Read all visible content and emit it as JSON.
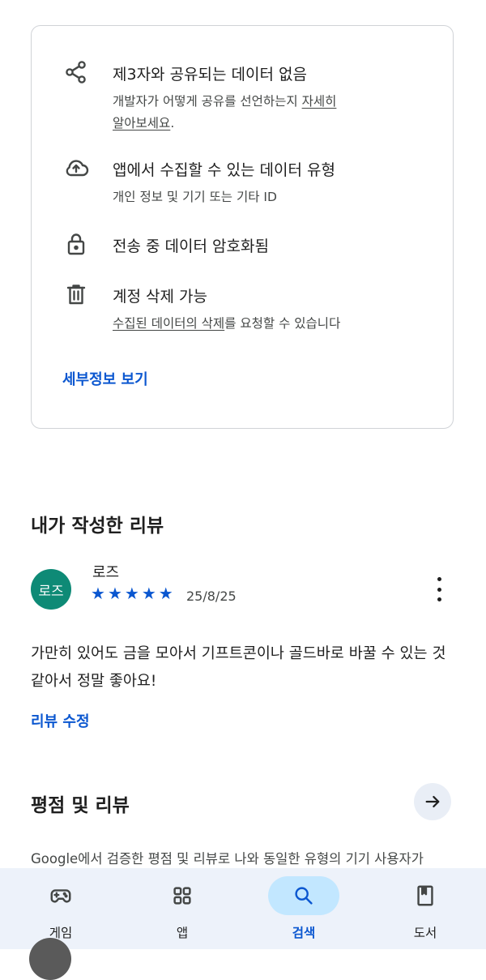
{
  "data_safety": {
    "items": [
      {
        "icon": "share-icon",
        "title": "제3자와 공유되는 데이터 없음",
        "sub_line1": "개발자가 어떻게 공유를 선언하는지 ",
        "sub_link1": "자세히",
        "sub_link2": "알아보세요",
        "sub_end": "."
      },
      {
        "icon": "cloud-upload-icon",
        "title": "앱에서 수집할 수 있는 데이터 유형",
        "sub": "개인 정보 및 기기 또는 기타 ID"
      },
      {
        "icon": "lock-icon",
        "title": "전송 중 데이터 암호화됨"
      },
      {
        "icon": "trash-icon",
        "title": "계정 삭제 가능",
        "sub_link": "수집된 데이터의 삭제",
        "sub_rest": "를 요청할 수 있습니다"
      }
    ],
    "details_link": "세부정보 보기"
  },
  "my_review": {
    "heading": "내가 작성한 리뷰",
    "avatar_text": "로즈",
    "avatar_color": "#0e8a76",
    "name": "로즈",
    "stars": 5,
    "date": "25/8/25",
    "text": "가만히 있어도 금을 모아서 기프트콘이나 골드바로 바꿀 수 있는 것 같아서 정말 좋아요!",
    "edit_link": "리뷰 수정"
  },
  "ratings": {
    "heading": "평점 및 리뷰",
    "description": "Google에서 검증한 평점 및 리뷰로 나와 동일한 유형의 기기 사용자가"
  },
  "bottom_nav": {
    "items": [
      {
        "label": "게임",
        "icon": "gamepad-icon",
        "active": false
      },
      {
        "label": "앱",
        "icon": "apps-grid-icon",
        "active": false
      },
      {
        "label": "검색",
        "icon": "search-icon",
        "active": true
      },
      {
        "label": "도서",
        "icon": "book-icon",
        "active": false
      }
    ]
  },
  "colors": {
    "accent": "#0b57d0",
    "nav_bg": "#edf2fa",
    "active_pill": "#c2e7ff"
  }
}
